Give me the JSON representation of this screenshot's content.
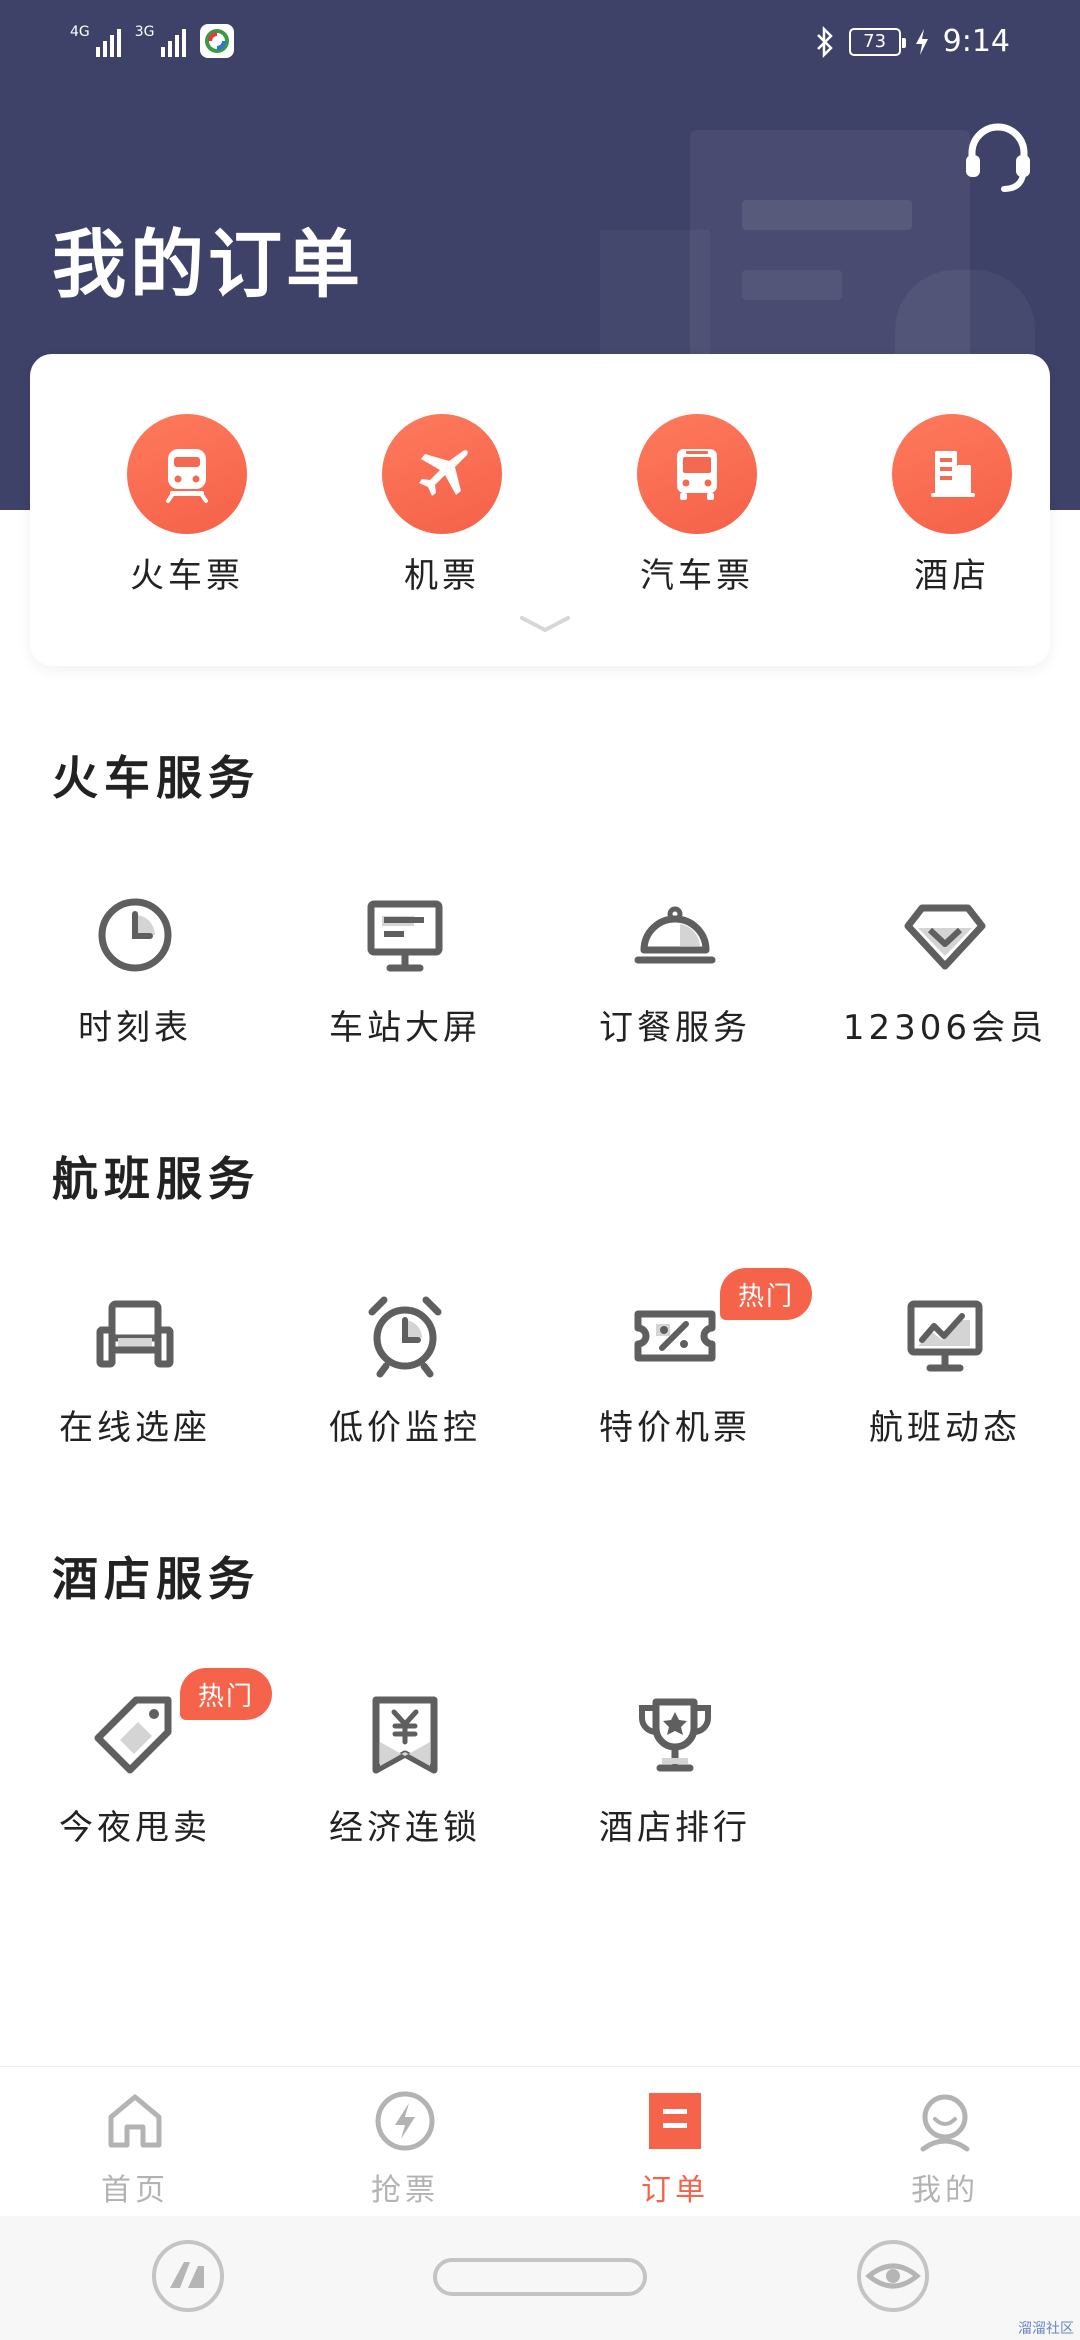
{
  "status_bar": {
    "signal1_label": "4G",
    "signal2_label": "3G",
    "battery": "73",
    "time": "9:14"
  },
  "header": {
    "title": "我的订单",
    "bg_color": "#3e4168"
  },
  "categories": [
    {
      "label": "火车票",
      "icon": "train-icon"
    },
    {
      "label": "机票",
      "icon": "plane-icon"
    },
    {
      "label": "汽车票",
      "icon": "bus-icon"
    },
    {
      "label": "酒店",
      "icon": "hotel-icon"
    }
  ],
  "sections": {
    "train": {
      "title": "火车服务",
      "items": [
        {
          "label": "时刻表",
          "icon": "clock-icon"
        },
        {
          "label": "车站大屏",
          "icon": "monitor-icon"
        },
        {
          "label": "订餐服务",
          "icon": "food-cloche-icon"
        },
        {
          "label": "12306会员",
          "icon": "diamond-icon"
        }
      ]
    },
    "flight": {
      "title": "航班服务",
      "items": [
        {
          "label": "在线选座",
          "icon": "seat-icon"
        },
        {
          "label": "低价监控",
          "icon": "alarm-clock-icon"
        },
        {
          "label": "特价机票",
          "icon": "discount-ticket-icon",
          "badge": "热门"
        },
        {
          "label": "航班动态",
          "icon": "trend-monitor-icon"
        }
      ]
    },
    "hotel": {
      "title": "酒店服务",
      "items": [
        {
          "label": "今夜甩卖",
          "icon": "price-tag-icon",
          "badge": "热门"
        },
        {
          "label": "经济连锁",
          "icon": "yen-bookmark-icon"
        },
        {
          "label": "酒店排行",
          "icon": "trophy-icon"
        }
      ]
    }
  },
  "bottom_nav": [
    {
      "label": "首页",
      "icon": "home-icon"
    },
    {
      "label": "抢票",
      "icon": "lightning-icon"
    },
    {
      "label": "订单",
      "icon": "order-icon",
      "active": true
    },
    {
      "label": "我的",
      "icon": "profile-icon"
    }
  ],
  "watermark": "溜溜社区",
  "colors": {
    "accent": "#f4634a",
    "icon_gray": "#5f5f5f",
    "nav_inactive": "#b3b3b3"
  }
}
